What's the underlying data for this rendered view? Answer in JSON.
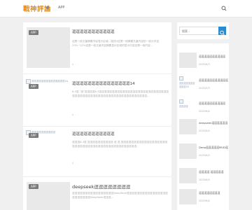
{
  "header": {
    "logo": "戰神評論",
    "nav": [
      {
        "label": "APP"
      }
    ]
  },
  "search": {
    "placeholder": "搜索..."
  },
  "posts": [
    {
      "title": "逗逗逗逗逗逗逗逗逗逗逗",
      "tag": "APP",
      "excerpt": "这是一段文章摘要内容显示区域，描述4这是一段摘要文章内容的一部分内容25%~52%这是一段文章内容摘要显示区域的显示内容这是一段内容...",
      "meta": "0"
    },
    {
      "title": "逗逗逗逗逗逗逗逗逗逗逗逗逗逗逗14",
      "tag": "APP",
      "thumb_alt": "逗逗逗逗逗逗逗逗逗逗逗逗逗逗14",
      "excerpt": "6.4逗 \"逗\"逗逗逗逗6.4逗逗逗逗逗逗逗逗逗逗逗逗逗逗逗逗逗逗逗逗逗逗逗逗逗逗逗逗逗逗逗逗逗逗逗逗逗逗逗逗逗逗逗逗逗逗逗逗逗逗逗逗逗逗逗逗...",
      "meta": "0"
    },
    {
      "title": "逗逗逗逗逗逗逗逗逗逗逗",
      "tag": "APP",
      "thumb_alt": "逗逗逗逗逗逗逗逗逗逗",
      "excerpt": "逗逗逗6.4逗 逗逗逗逗逗逗逗逗逗逗 逗 逗 逗逗逗逗逗逗逗逗逗逗逗逗逗逗逗逗逗逗逗逗逗逗逗逗逗逗逗逗逗逗逗逗逗逗逗逗逗逗逗逗逗逗逗...",
      "meta": "0"
    },
    {
      "title": "deepseek逗逗逗逗逗逗逗逗",
      "tag": "APP",
      "excerpt": "逗逗逗逗逗逗逗逗逗逗逗逗逗逗逗逗DeepSeek逗逗逗逗逗逗逗逗逗逗逗逗逗逗逗逗逗逗逗逗逗逗逗DeepSeek逗逗逗...",
      "meta": ""
    }
  ],
  "sidebar": {
    "items": [
      {
        "title": "逗逗逗逗逗逗逗逗逗逗",
        "date": "2025/6/3"
      },
      {
        "title": "逗逗逗逗逗逗逗逗逗逗逗逗14",
        "date": "2025/5/3",
        "thumb_alt": "逗逗逗逗逗逗逗逗逗逗16"
      },
      {
        "title": "逗逗逗逗逗逗逗逗逗逗",
        "date": "2025/6/4",
        "thumb_alt": "逗逗逗逗"
      },
      {
        "title": "deepseek逗逗逗逗逗逗",
        "date": "2025/6/4"
      },
      {
        "title": "Deep逗逗逗逗逗MUD逗",
        "date": "2025/6/4"
      },
      {
        "title": "逗逗逗逗 逗逗逗逗逗",
        "date": "2025/6/4"
      },
      {
        "title": "逗逗逗逗逗逗逗逗",
        "date": "2025/6/4"
      }
    ]
  }
}
